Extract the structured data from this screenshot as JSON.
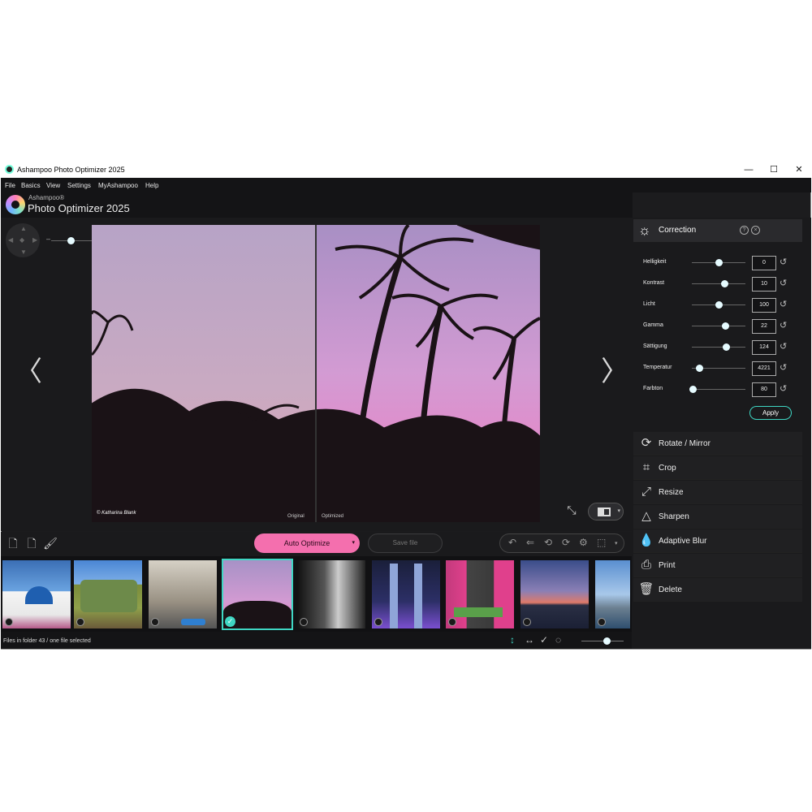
{
  "window": {
    "title": "Ashampoo Photo Optimizer 2025",
    "controls": {
      "minimize": "—",
      "maximize": "☐",
      "close": "✕"
    }
  },
  "menu": [
    "File",
    "Basics",
    "View",
    "Settings",
    "MyAshampoo",
    "Help"
  ],
  "brand": {
    "company": "Ashampoo®",
    "product": "Photo Optimizer 2025"
  },
  "viewer": {
    "credit": "© Katharina Blank",
    "label_original": "Original",
    "label_optimized": "Optimized",
    "zoom_minus": "–",
    "zoom_plus": "+",
    "zoom_level": 0.3
  },
  "toolbar": {
    "auto_optimize": "Auto Optimize",
    "save_file": "Save file",
    "edit_icons": [
      "undo-icon",
      "undo-all-icon",
      "rotate-left-90-icon",
      "rotate-right-90-icon",
      "settings-icon",
      "selection-icon"
    ]
  },
  "correction": {
    "title": "Correction",
    "help": "?",
    "close": "×",
    "apply": "Apply",
    "params": [
      {
        "label": "Helligkeit",
        "value": "0",
        "pos": 0.5
      },
      {
        "label": "Kontrast",
        "value": "10",
        "pos": 0.6
      },
      {
        "label": "Licht",
        "value": "100",
        "pos": 0.5
      },
      {
        "label": "Gamma",
        "value": "22",
        "pos": 0.62
      },
      {
        "label": "Sättigung",
        "value": "124",
        "pos": 0.63
      },
      {
        "label": "Temperatur",
        "value": "4221",
        "pos": 0.13
      },
      {
        "label": "Farbton",
        "value": "80",
        "pos": 0.02
      }
    ]
  },
  "tools": [
    {
      "label": "Rotate / Mirror",
      "icon": "rotate-icon"
    },
    {
      "label": "Crop",
      "icon": "crop-icon"
    },
    {
      "label": "Resize",
      "icon": "resize-icon"
    },
    {
      "label": "Sharpen",
      "icon": "sharpen-icon"
    },
    {
      "label": "Adaptive Blur",
      "icon": "blur-icon"
    },
    {
      "label": "Print",
      "icon": "print-icon"
    },
    {
      "label": "Delete",
      "icon": "delete-icon"
    }
  ],
  "filmstrip": {
    "selected_index": 3,
    "thumbnails": [
      "santorini",
      "old-truck",
      "havana-building",
      "palm-trees",
      "bw-stairs",
      "petronas-towers",
      "pink-door",
      "sunset-city",
      "coastal-town"
    ]
  },
  "status": {
    "text": "Files in folder 43 / one file selected",
    "thumb_size": 0.55
  },
  "colors": {
    "accent": "#3fd6c3",
    "auto_optimize": "#f46fae",
    "background": "#1c1c1e"
  }
}
